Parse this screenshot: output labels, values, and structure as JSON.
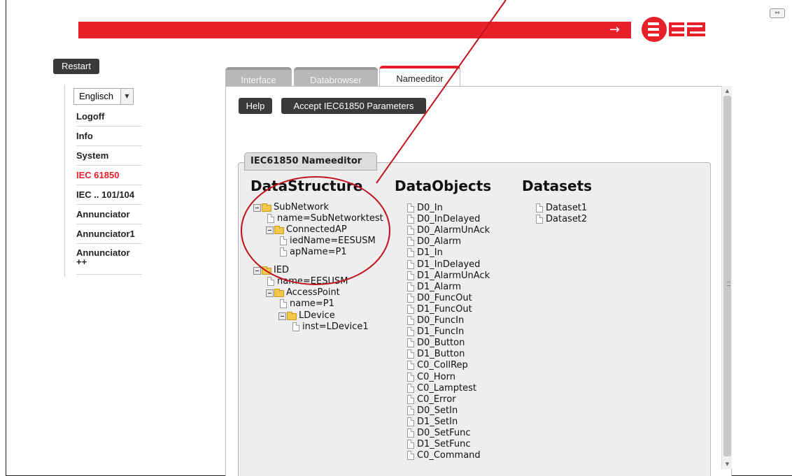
{
  "header": {
    "arrow": "→",
    "logo_text": "EES"
  },
  "restart_label": "Restart",
  "language": {
    "selected": "Englisch"
  },
  "menu": [
    {
      "label": "Logoff",
      "active": false
    },
    {
      "label": "Info",
      "active": false
    },
    {
      "label": "System",
      "active": false
    },
    {
      "label": "IEC 61850",
      "active": true
    },
    {
      "label": "IEC .. 101/104",
      "active": false
    },
    {
      "label": "Annunciator",
      "active": false
    },
    {
      "label": "Annunciator1",
      "active": false
    },
    {
      "label": "Annunciator\n++",
      "active": false
    }
  ],
  "tabs": [
    {
      "label": "Interface",
      "active": false
    },
    {
      "label": "Databrowser",
      "active": false
    },
    {
      "label": "Nameeditor",
      "active": true
    }
  ],
  "buttons": {
    "help": "Help",
    "accept": "Accept IEC61850 Parameters"
  },
  "panel": {
    "title": "IEC61850 Nameeditor",
    "columns": {
      "structure": "DataStructure",
      "objects": "DataObjects",
      "datasets": "Datasets"
    },
    "structure": [
      {
        "type": "folder",
        "level": 0,
        "label": "SubNetwork"
      },
      {
        "type": "file",
        "level": 1,
        "label": "name=SubNetworktest"
      },
      {
        "type": "folder",
        "level": 1,
        "label": "ConnectedAP"
      },
      {
        "type": "file",
        "level": 2,
        "label": "iedName=EESUSM"
      },
      {
        "type": "file",
        "level": 2,
        "label": "apName=P1"
      },
      {
        "type": "gap"
      },
      {
        "type": "folder",
        "level": 0,
        "label": "IED"
      },
      {
        "type": "file",
        "level": 1,
        "label": "name=EESUSM"
      },
      {
        "type": "folder",
        "level": 1,
        "label": "AccessPoint"
      },
      {
        "type": "file",
        "level": 2,
        "label": "name=P1"
      },
      {
        "type": "folder",
        "level": 2,
        "label": "LDevice"
      },
      {
        "type": "file",
        "level": 3,
        "label": "inst=LDevice1"
      }
    ],
    "objects": [
      "D0_In",
      "D0_InDelayed",
      "D0_AlarmUnAck",
      "D0_Alarm",
      "D1_In",
      "D1_InDelayed",
      "D1_AlarmUnAck",
      "D1_Alarm",
      "D0_FuncOut",
      "D1_FuncOut",
      "D0_FuncIn",
      "D1_FuncIn",
      "D0_Button",
      "D1_Button",
      "C0_CollRep",
      "C0_Horn",
      "C0_Lamptest",
      "C0_Error",
      "D0_SetIn",
      "D1_SetIn",
      "D0_SetFunc",
      "D1_SetFunc",
      "C0_Command"
    ],
    "datasets": [
      "Dataset1",
      "Dataset2"
    ]
  },
  "colors": {
    "brand_red": "#e8202a",
    "button_dark": "#3a3a3a",
    "panel_bg": "#eeeeee",
    "annotation": "#c0141e"
  },
  "icons": {
    "folder": "folder-icon",
    "file": "file-icon",
    "collapse": "collapse-minus-icon"
  }
}
